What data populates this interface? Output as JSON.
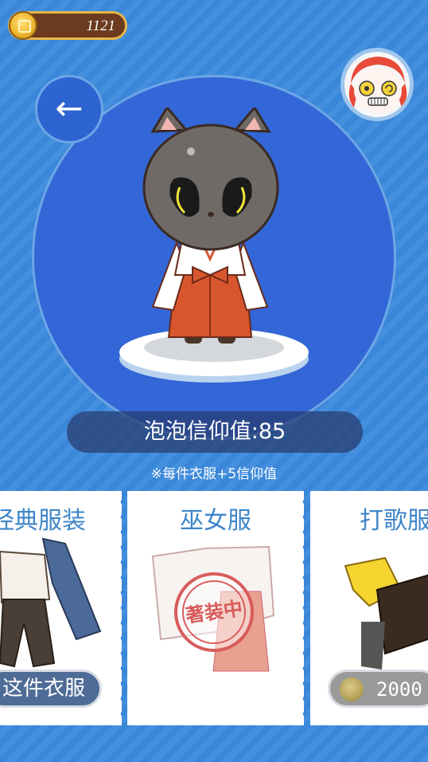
{
  "currency": {
    "coins": "1121",
    "icon": "coin-icon"
  },
  "navigation": {
    "back_label": "←"
  },
  "stage": {
    "faith_label": "泡泡信仰值:85",
    "note": "※每件衣服+5信仰值"
  },
  "outfits": [
    {
      "title": "经典服装",
      "action_label": "这件衣服",
      "status": "available"
    },
    {
      "title": "巫女服",
      "stamp_label": "著装中",
      "status": "equipped"
    },
    {
      "title": "打歌服",
      "price": "2000",
      "status": "locked"
    }
  ],
  "colors": {
    "background": "#3a86d8",
    "accent_title": "#3e86c8",
    "stamp": "#d85c5c"
  }
}
